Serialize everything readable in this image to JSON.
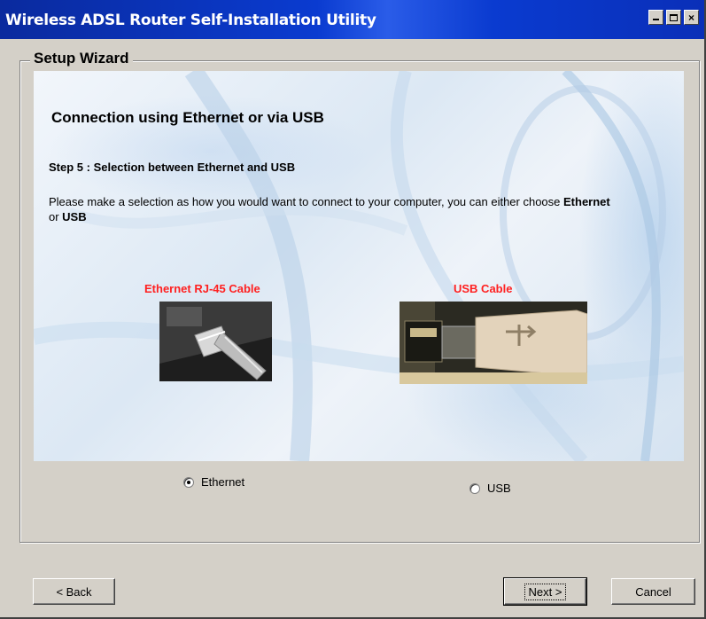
{
  "window": {
    "title": "Wireless ADSL Router Self-Installation Utility",
    "controls": [
      "minimize-icon",
      "maximize-icon",
      "close-icon"
    ],
    "close_glyph": "×"
  },
  "wizard": {
    "group_label": "Setup Wizard",
    "heading": "Connection using Ethernet or via USB",
    "step": "Step 5 : Selection between Ethernet and USB",
    "description_part1": "Please make a selection as how you would want to connect to your computer, you can either choose ",
    "ethernet_word": "Ethernet",
    "or_word": " or ",
    "usb_word": "USB",
    "ethernet_image_label": "Ethernet RJ-45 Cable",
    "usb_image_label": "USB Cable"
  },
  "options": {
    "ethernet_label": "Ethernet",
    "ethernet_checked": true,
    "usb_label": "USB",
    "usb_checked": false
  },
  "buttons": {
    "back": "< Back",
    "next": "Next >",
    "cancel": "Cancel"
  },
  "colors": {
    "title_bar": "#0a3bd0",
    "dialog_face": "#d4d0c8",
    "image_label": "#ff2020"
  }
}
